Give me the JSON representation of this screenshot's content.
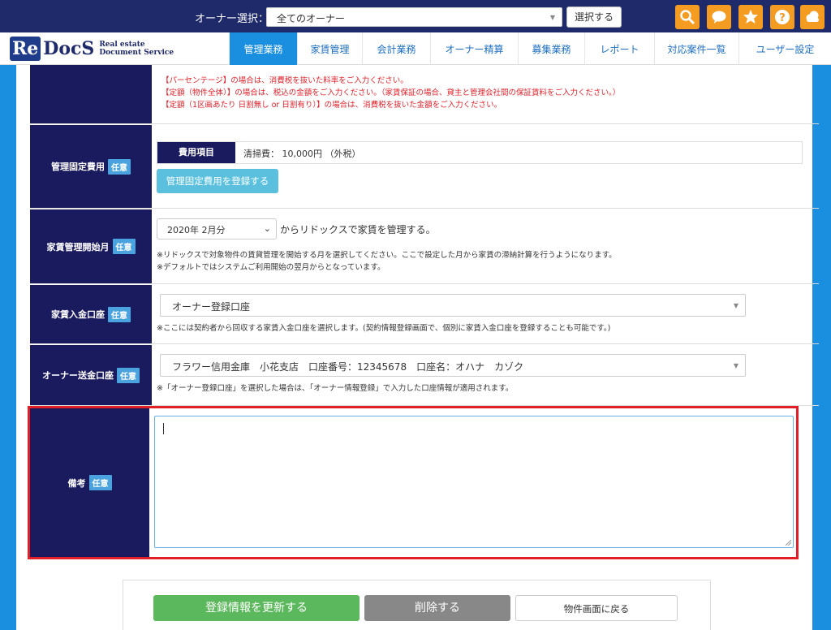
{
  "topbar": {
    "owner_label": "オーナー選択：",
    "owner_value": "全てのオーナー",
    "select_button": "選択する",
    "icons": [
      "search-icon",
      "chat-icon",
      "star-icon",
      "help-icon",
      "cloud-icon"
    ],
    "accent": "#f39c21"
  },
  "logo": {
    "re": "Re",
    "docs": "DocS",
    "sub1": "Real estate",
    "sub2": "Document Service"
  },
  "nav": {
    "tabs": [
      "管理業務",
      "家賃管理",
      "会計業務",
      "オーナー精算",
      "募集業務",
      "レポート",
      "対応案件一覧",
      "ユーザー設定"
    ],
    "active_index": 0
  },
  "form": {
    "badge": "任意",
    "fee_rate_notes": [
      "【パーセンテージ】の場合は、消費税を抜いた料率をご入力ください。",
      "【定額（物件全体）】の場合は、税込の金額をご入力ください。（家賃保証の場合、貸主と管理会社間の保証賃料をご入力ください。）",
      "【定額（1区画あたり 日割無し or 日割有り）】の場合は、消費税を抜いた金額をご入力ください。"
    ],
    "fixed_cost": {
      "label": "管理固定費用",
      "item_header": "費用項目",
      "item_value": "清掃費： 10,000円 （外税）",
      "register_button": "管理固定費用を登録する"
    },
    "start_month": {
      "label": "家賃管理開始月",
      "value": "2020年 2月分",
      "suffix": "からリドックスで家賃を管理する。",
      "note1": "※リドックスで対象物件の賃貸管理を開始する月を選択してください。ここで設定した月から家賃の滞納計算を行うようになります。",
      "note2": "※デフォルトではシステムご利用開始の翌月からとなっています。"
    },
    "rent_account": {
      "label": "家賃入金口座",
      "value": "オーナー登録口座",
      "note": "※ここには契約者から回収する家賃入金口座を選択します。(契約情報登録画面で、個別に家賃入金口座を登録することも可能です。)"
    },
    "owner_account": {
      "label": "オーナー送金口座",
      "value": "フラワー信用金庫　小花支店　口座番号：12345678　口座名：オハナ　カゾク",
      "note": "※「オーナー登録口座」を選択した場合は、「オーナー情報登録」で入力した口座情報が適用されます。"
    },
    "remarks": {
      "label": "備考",
      "value": ""
    }
  },
  "actions": {
    "update": "登録情報を更新する",
    "delete": "削除する",
    "back": "物件画面に戻る"
  }
}
